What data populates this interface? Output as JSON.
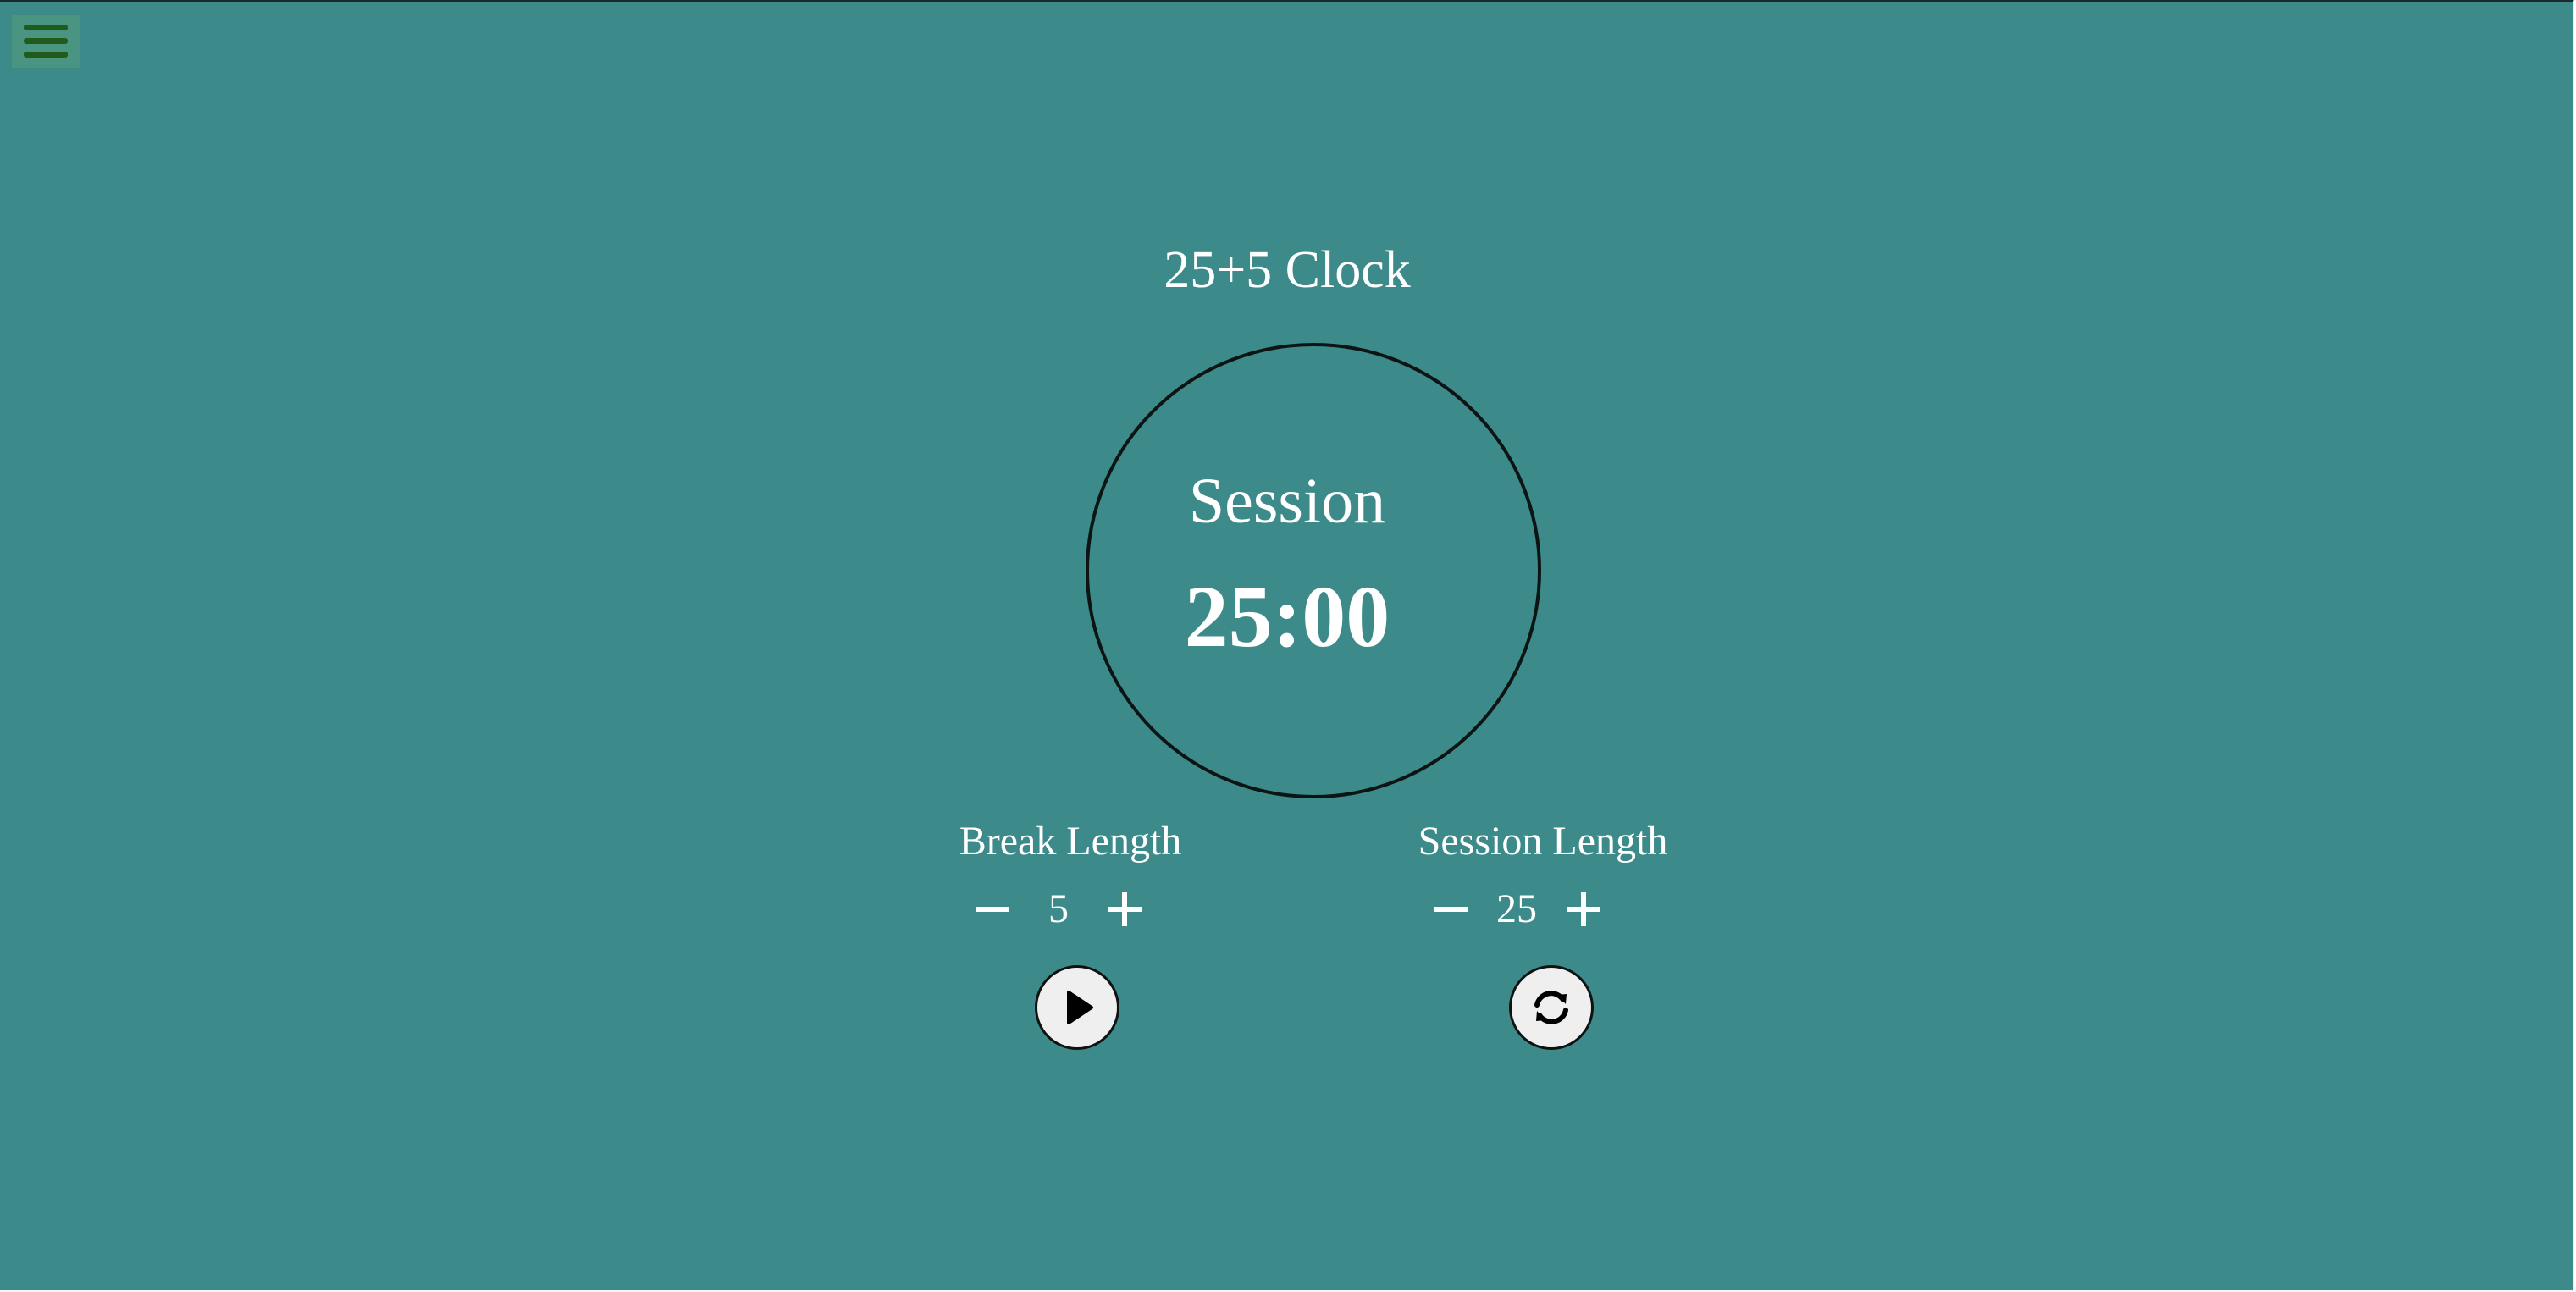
{
  "colors": {
    "background": "#3d8a8a",
    "text": "#ffffff",
    "menu_icon": "#1f5c1a",
    "button_face": "#efefef"
  },
  "header": {
    "menu_icon": "hamburger-menu-icon"
  },
  "clock": {
    "title": "25+5 Clock",
    "timer_label": "Session",
    "time_left": "25:00"
  },
  "break": {
    "label": "Break Length",
    "value": "5",
    "decrement_icon": "minus-icon",
    "increment_icon": "plus-icon"
  },
  "session": {
    "label": "Session Length",
    "value": "25",
    "decrement_icon": "minus-icon",
    "increment_icon": "plus-icon"
  },
  "controls": {
    "start_stop_icon": "play-icon",
    "reset_icon": "refresh-icon"
  }
}
